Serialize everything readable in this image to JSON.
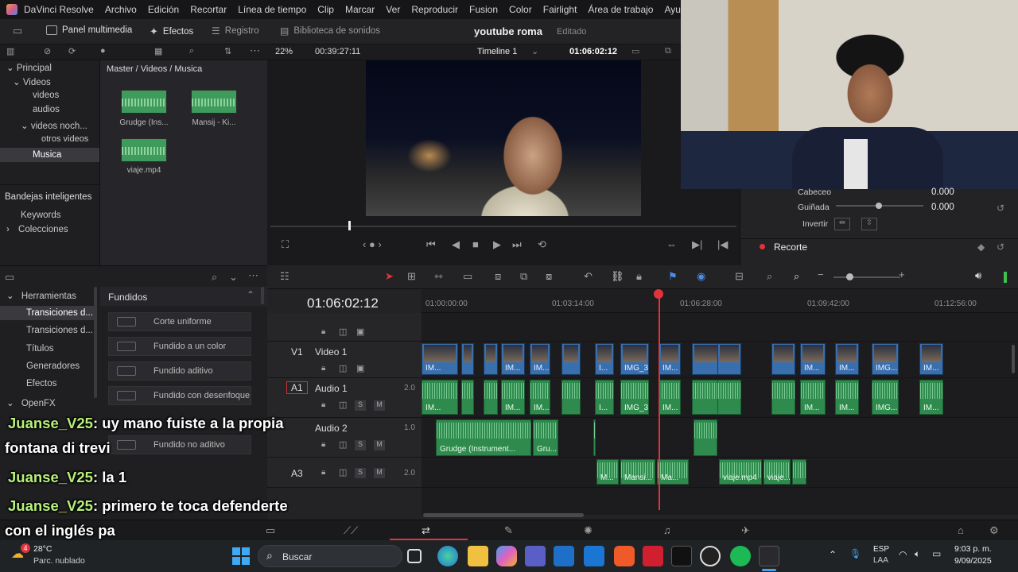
{
  "menu": {
    "app": "DaVinci Resolve",
    "items": [
      "Archivo",
      "Edición",
      "Recortar",
      "Línea de tiempo",
      "Clip",
      "Marcar",
      "Ver",
      "Reproducir",
      "Fusion",
      "Color",
      "Fairlight",
      "Área de trabajo",
      "Ayuda"
    ]
  },
  "toolbar": {
    "media_panel": "Panel multimedia",
    "effects": "Efectos",
    "index": "Registro",
    "sound_library": "Biblioteca de sonidos",
    "project_title": "youtube roma",
    "project_state": "Editado"
  },
  "subbar": {
    "zoom": "22%",
    "source_tc": "00:39:27:11",
    "timeline_name": "Timeline 1",
    "record_tc": "01:06:02:12"
  },
  "bins": {
    "items": [
      {
        "label": "Principal",
        "level": 0
      },
      {
        "label": "Videos",
        "level": 1
      },
      {
        "label": "videos",
        "level": 2
      },
      {
        "label": "audios",
        "level": 2
      },
      {
        "label": "videos noch...",
        "level": 2
      },
      {
        "label": "otros videos",
        "level": 3
      },
      {
        "label": "Musica",
        "level": 1,
        "selected": true
      }
    ],
    "smart_bins": "Bandejas inteligentes",
    "keywords": "Keywords",
    "collections": "Colecciones"
  },
  "media_pool": {
    "breadcrumb": "Master / Videos / Musica",
    "clips": [
      "Grudge (Ins...",
      "Mansij - Ki...",
      "viaje.mp4"
    ]
  },
  "inspector": {
    "row1_label": "Cabeceo",
    "row1_value": "0.000",
    "row2_label": "Guiñada",
    "row2_value": "0.000",
    "row3_label": "Invertir",
    "section": "Recorte"
  },
  "effects_panel": {
    "toolbox": "Herramientas",
    "items": [
      "Transiciones d...",
      "Transiciones d...",
      "Títulos",
      "Generadores",
      "Efectos"
    ],
    "openfx": "OpenFX",
    "category": "Fundidos",
    "fx": [
      "Corte uniforme",
      "Fundido a un color",
      "Fundido aditivo",
      "Fundido con desenfoque",
      "Fundido no aditivo"
    ]
  },
  "timeline": {
    "timecode": "01:06:02:12",
    "ruler": [
      "01:00:00:00",
      "01:03:14:00",
      "01:06:28:00",
      "01:09:42:00",
      "01:12:56:00"
    ],
    "tracks": [
      {
        "id": "V1",
        "name": "Video 1",
        "level": ""
      },
      {
        "id": "A1",
        "name": "Audio 1",
        "level": "2.0"
      },
      {
        "id": "A2",
        "name": "Audio 2",
        "level": "1.0"
      },
      {
        "id": "A3",
        "name": "",
        "level": "2.0"
      }
    ],
    "video_clip_labels": [
      "IM...",
      "IM...",
      "IM...",
      "I...",
      "IMG_3...",
      "IM...",
      "IM...",
      "IM...",
      "IMG...",
      "IM..."
    ],
    "audio1_clip_labels": [
      "IM...",
      "IM...",
      "IM...",
      "I...",
      "IMG_3...",
      "IM...",
      "IM...",
      "IM...",
      "IMG...",
      "IM..."
    ],
    "audio2_clip_labels": [
      "Grudge (Instrument...",
      "Gru..."
    ],
    "audio3_clip_labels": [
      "M...",
      "Mansi...",
      "Ma...",
      "viaje.mp4",
      "viaje..."
    ],
    "solo": "S",
    "mute": "M"
  },
  "chat": [
    {
      "user": "Juanse_V25",
      "text": ": uy mano fuiste a la propia"
    },
    {
      "user": "",
      "text": "fontana di trevi"
    },
    {
      "user": "Juanse_V25",
      "text": ": la 1"
    },
    {
      "user": "Juanse_V25",
      "text": ": primero te toca defenderte"
    },
    {
      "user": "",
      "text": "con el inglés pa"
    }
  ],
  "taskbar": {
    "weather_temp": "28°C",
    "weather_desc": "Parc. nublado",
    "weather_badge": "4",
    "search": "Buscar",
    "lang1": "ESP",
    "lang2": "LAA",
    "time": "9:03 p. m.",
    "date": "9/09/2025"
  },
  "colors": {
    "video_clip": "#3a6fae",
    "audio_clip": "#2f8a4e",
    "playhead": "#e0343c",
    "accent_pagebar": "#e0343c"
  }
}
